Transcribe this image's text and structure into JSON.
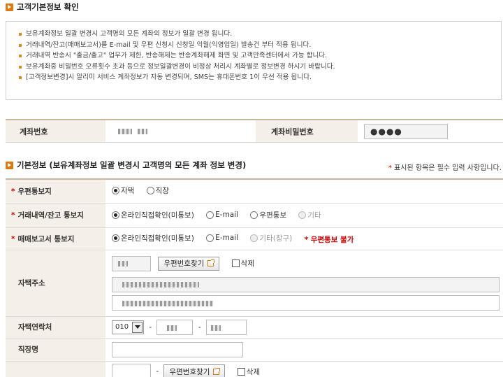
{
  "section1": {
    "title": "고객기본정보 확인"
  },
  "notices": [
    "보유계좌정보 일괄 변경시 고객명의 모든 계좌의 정보가 일괄 변경 됩니다.",
    "거래내역/잔고(매매보고서)를 E-mail 및 우편 신청시 신청일 익월(익영업일) 발송건 부터 적용 됩니다.",
    "거래내역 반송시 \"출금/출고\" 업무가 제한, 반송해제는 반송계좌해제 화면 및 고객만족센터에서 가능 합니다.",
    "보유계좌중 비밀번호 오류횟수 초과 등으로 정보일괄변경이 비정상 처리시 계좌별로 정보변경 하시기 바랍니다.",
    "[고객정보변경]시 알리미 서비스 계좌정보가 자동 변경되며, SMS는 휴대폰번호 1이 우선 적용 됩니다."
  ],
  "account": {
    "number_label": "계좌번호",
    "password_label": "계좌비밀번호",
    "password_value": "●●●●"
  },
  "section2": {
    "title": "기본정보 (보유계좌정보 일괄 변경시 고객명의 모든 계좌 정보 변경)",
    "required_note_star": "*",
    "required_note": "표시된 항목은 필수 입력 사항입니다."
  },
  "rows": {
    "mail": {
      "label": "우편통보지",
      "options": [
        "자택",
        "직장"
      ]
    },
    "trade": {
      "label": "거래내역/잔고 통보지",
      "options": [
        "온라인직접확인(미통보)",
        "E-mail",
        "우편통보",
        "기타"
      ]
    },
    "report": {
      "label": "매매보고서 통보지",
      "options": [
        "온라인직접확인(미통보)",
        "E-mail",
        "기타(창구)"
      ],
      "warning": "* 우편통보 불가"
    },
    "home_address": {
      "label": "자택주소",
      "zip_button": "우편번호찾기",
      "delete_label": "삭제"
    },
    "home_phone": {
      "label": "자택연락처",
      "area_code": "010",
      "dash": "-"
    },
    "workplace": {
      "label": "직장명"
    },
    "work_address": {
      "zip_button": "우편번호찾기",
      "delete_label": "삭제",
      "dash": "-"
    }
  },
  "colors": {
    "accent": "#e07810",
    "label_bg": "#f4efe8",
    "border_top": "#c9b79c",
    "warning": "#cc0000"
  }
}
